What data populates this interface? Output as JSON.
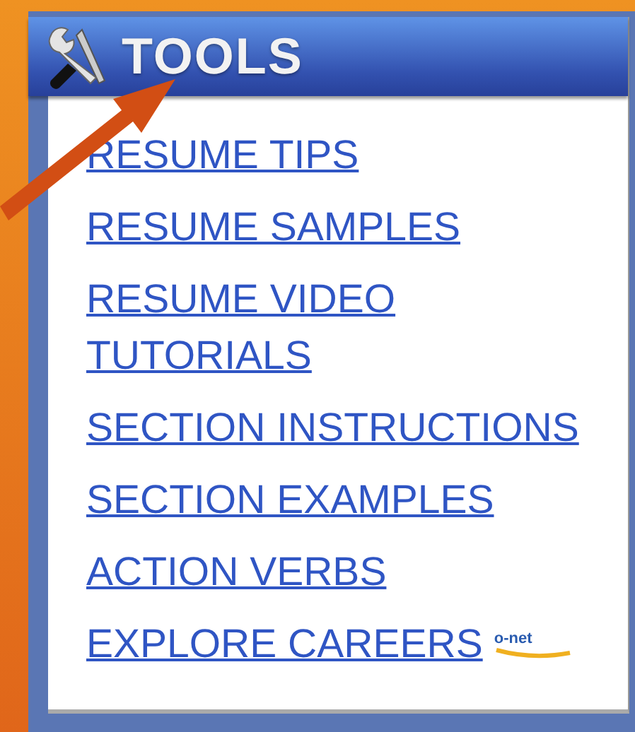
{
  "panel": {
    "title": "TOOLS",
    "links": [
      {
        "label": "RESUME TIPS"
      },
      {
        "label": "RESUME SAMPLES"
      },
      {
        "label": "RESUME VIDEO TUTORIALS"
      },
      {
        "label": "SECTION INSTRUCTIONS"
      },
      {
        "label": "SECTION EXAMPLES"
      },
      {
        "label": "ACTION VERBS"
      },
      {
        "label": "EXPLORE CAREERS",
        "badge": "o-net"
      }
    ]
  }
}
